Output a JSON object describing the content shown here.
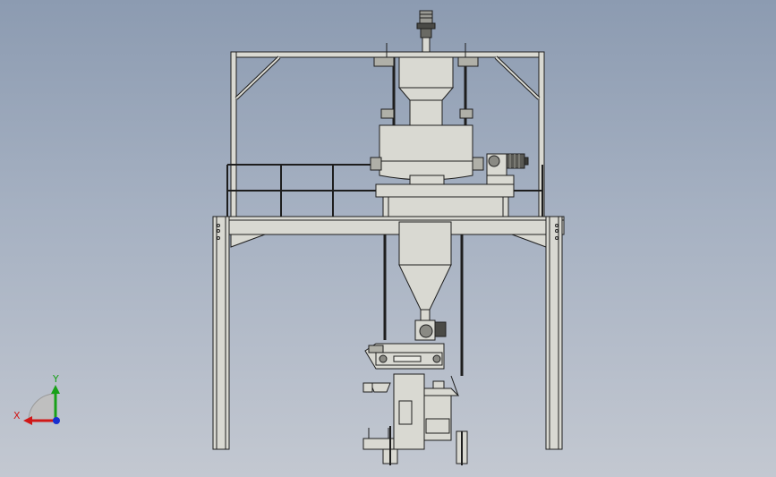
{
  "view": {
    "background_top": "#8c9bb1",
    "background_bottom": "#c3c8d1",
    "model_fill": "#d9d9d2",
    "model_stroke": "#1e1e1e"
  },
  "triad": {
    "x_label": "X",
    "y_label": "Y",
    "x_color": "#d01818",
    "y_color": "#18a018",
    "z_color": "#1830d0"
  }
}
